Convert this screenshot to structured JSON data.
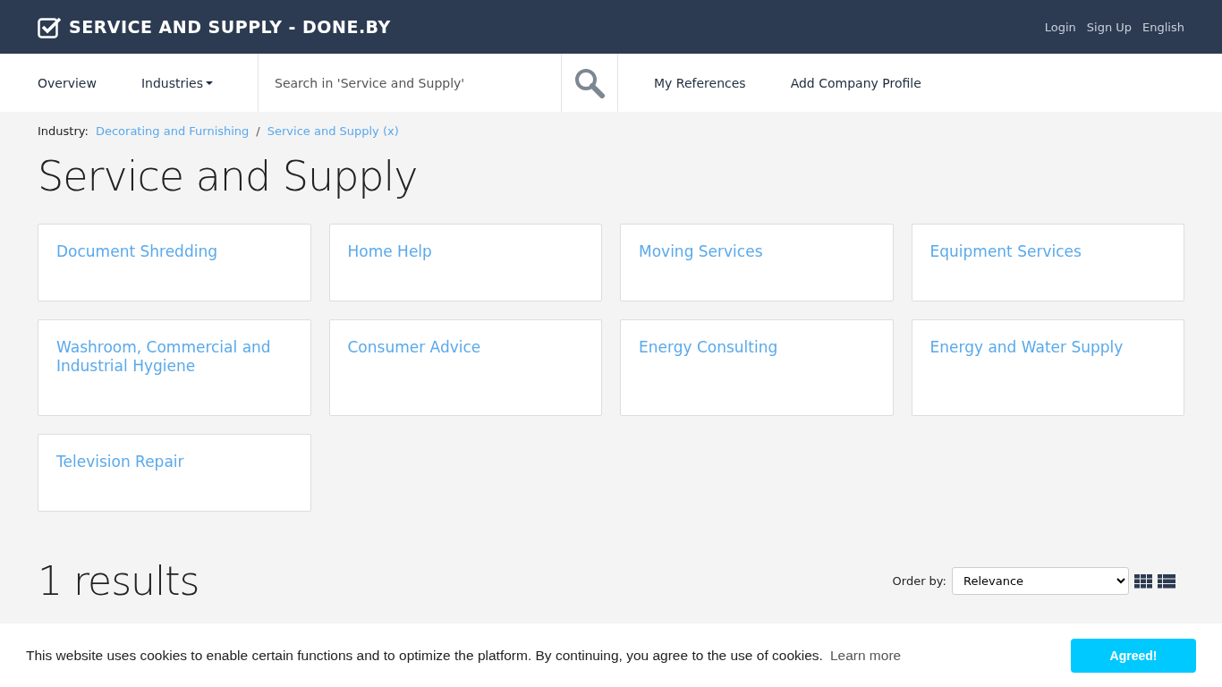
{
  "header": {
    "title": "SERVICE AND SUPPLY - DONE.BY",
    "links": [
      "Login",
      "Sign Up",
      "English"
    ]
  },
  "nav": {
    "items_left": [
      {
        "label": "Overview",
        "kind": "link"
      },
      {
        "label": "Industries",
        "kind": "dropdown"
      }
    ],
    "search": {
      "placeholder": "Search in 'Service and Supply'"
    },
    "items_right": [
      "My References",
      "Add Company Profile"
    ]
  },
  "breadcrumb": {
    "label": "Industry:",
    "items": [
      "Decorating and Furnishing",
      "Service and Supply (x)"
    ],
    "separator": "/"
  },
  "heading": "Service and Supply",
  "categories": [
    {
      "label": "Document Shredding"
    },
    {
      "label": "Home Help"
    },
    {
      "label": "Moving Services"
    },
    {
      "label": "Equipment Services"
    },
    {
      "label": "Washroom, Commercial and Industrial Hygiene"
    },
    {
      "label": "Consumer Advice"
    },
    {
      "label": "Energy Consulting"
    },
    {
      "label": "Energy and Water Supply"
    },
    {
      "label": "Television Repair"
    }
  ],
  "results": {
    "count": "1 results",
    "order_label": "Order by:",
    "order_value": "Relevance"
  },
  "cookie_bar": {
    "text": "This website uses cookies to enable certain functions and to optimize the platform. By continuing, you agree to the use of cookies.",
    "link": "Learn more",
    "button": "Agreed!"
  }
}
